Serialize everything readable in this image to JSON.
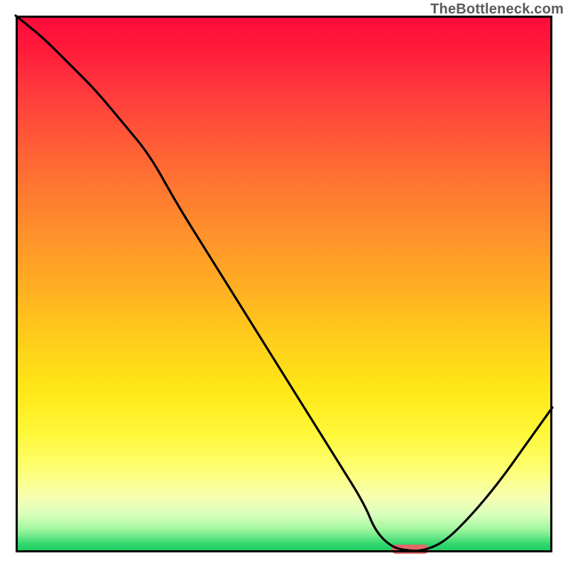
{
  "watermark": "TheBottleneck.com",
  "chart_data": {
    "type": "line",
    "title": "",
    "xlabel": "",
    "ylabel": "",
    "xlim": [
      0,
      100
    ],
    "ylim": [
      0,
      100
    ],
    "grid": false,
    "legend": false,
    "background": "gradient-red-to-green",
    "series": [
      {
        "name": "bottleneck-curve",
        "color": "#000000",
        "x": [
          0,
          5,
          10,
          15,
          20,
          25,
          30,
          35,
          40,
          45,
          50,
          55,
          60,
          65,
          67,
          70,
          73,
          76,
          80,
          85,
          90,
          95,
          100
        ],
        "y": [
          100,
          96,
          91,
          86,
          80,
          74,
          65,
          57,
          49,
          41,
          33,
          25,
          17,
          9,
          4,
          1,
          0.3,
          0.3,
          2,
          7,
          13,
          20,
          27
        ]
      }
    ],
    "annotations": [
      {
        "name": "optimal-marker",
        "shape": "rounded-bar",
        "color": "#e06a6a",
        "x_start": 70,
        "x_end": 77,
        "y": 0.6
      }
    ]
  }
}
